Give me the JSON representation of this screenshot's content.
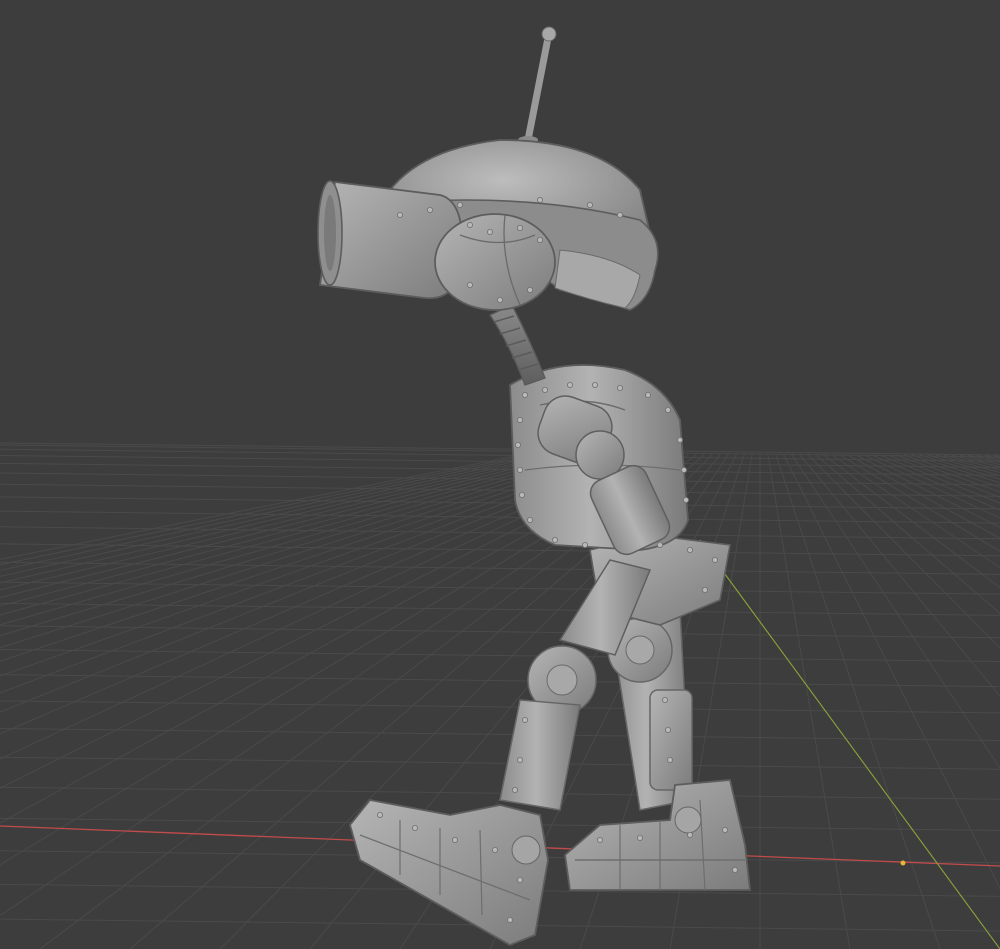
{
  "viewport": {
    "background_color": "#3d3d3d",
    "grid_color": "#4a4a4a",
    "x_axis_color": "#c24b4b",
    "y_axis_color": "#8aa43a",
    "model_color": "#9a9a9a",
    "model_highlight": "#b9b9b9",
    "model_shadow": "#6e6e6e",
    "origin_marker_color": "#e8b43a"
  },
  "scene": {
    "object": "robot-sculpt-model",
    "shading": "solid"
  }
}
